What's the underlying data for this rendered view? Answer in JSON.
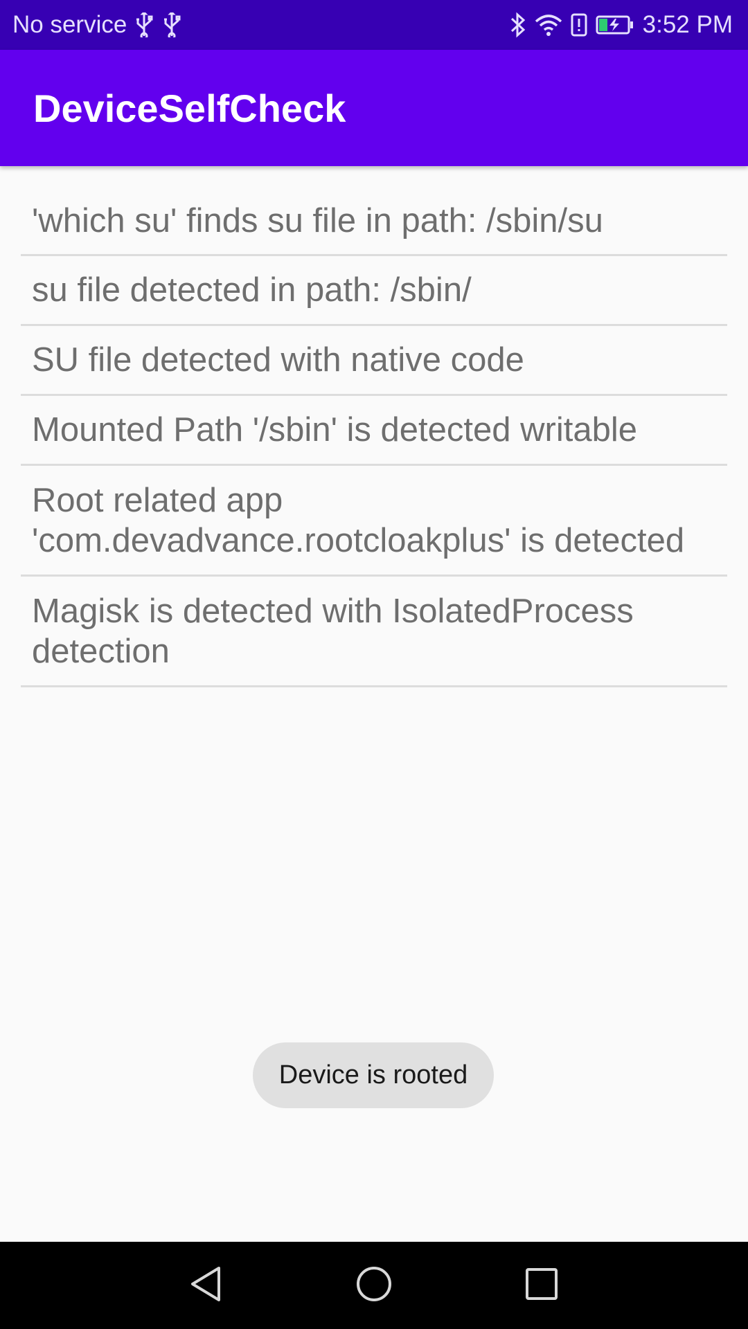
{
  "status_bar": {
    "carrier": "No service",
    "time": "3:52 PM",
    "icons": [
      "usb-icon",
      "usb-icon",
      "bluetooth-icon",
      "wifi-icon",
      "alert-icon",
      "battery-charging-icon"
    ]
  },
  "app_bar": {
    "title": "DeviceSelfCheck"
  },
  "checks": [
    {
      "text": "'which su' finds su file in path: /sbin/su"
    },
    {
      "text": "su file detected in path: /sbin/"
    },
    {
      "text": "SU file detected with native code"
    },
    {
      "text": "Mounted Path '/sbin' is detected writable"
    },
    {
      "text": "Root related app 'com.devadvance.rootcloakplus' is detected"
    },
    {
      "text": "Magisk is detected with IsolatedProcess detection"
    }
  ],
  "toast": {
    "text": "Device is rooted"
  },
  "nav_bar": {
    "buttons": [
      "back-icon",
      "home-icon",
      "recents-icon"
    ]
  },
  "colors": {
    "status_bar": "#3700b3",
    "app_bar": "#6200ee",
    "background": "#fafafa",
    "divider": "#dcdcdc",
    "toast": "#e0e0e0",
    "nav_bar": "#000000"
  }
}
